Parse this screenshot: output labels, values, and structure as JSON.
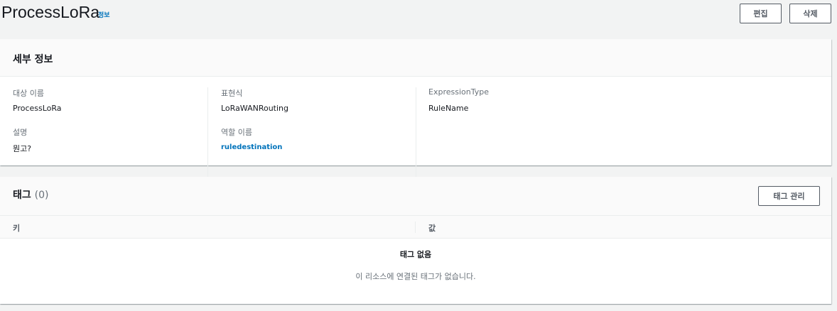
{
  "header": {
    "title": "ProcessLoRa",
    "info_link": "정보",
    "edit_label": "편집",
    "delete_label": "삭제"
  },
  "details": {
    "title": "세부 정보",
    "fields": {
      "target_name_label": "대상 이름",
      "target_name_value": "ProcessLoRa",
      "expression_label": "표현식",
      "expression_value": "LoRaWANRouting",
      "expression_type_label": "ExpressionType",
      "expression_type_value": "RuleName",
      "description_label": "설명",
      "description_value": "뭔고?",
      "role_name_label": "역할 이름",
      "role_name_value": "ruledestination"
    }
  },
  "tags": {
    "title": "태그",
    "count": "(0)",
    "manage_label": "태그 관리",
    "columns": [
      "키",
      "값"
    ],
    "empty_title": "태그 없음",
    "empty_desc": "이 리소스에 연결된 태그가 없습니다."
  },
  "colors": {
    "background": "#f2f3f3",
    "link": "#0073bb",
    "text": "#16191f",
    "muted": "#687078"
  }
}
